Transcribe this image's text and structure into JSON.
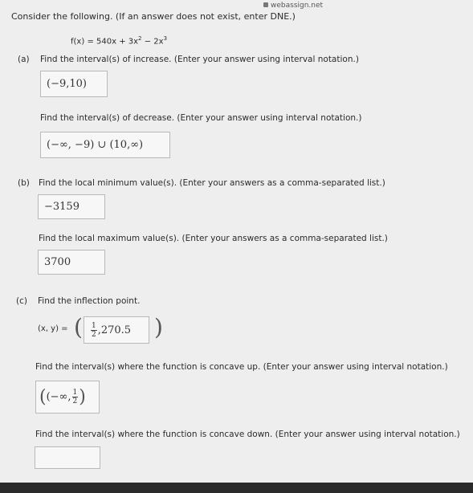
{
  "browser": {
    "url": "webassign.net"
  },
  "intro": "Consider the following. (If an answer does not exist, enter DNE.)",
  "function": {
    "lhs": "f(x)",
    "rhs_a": "540x + 3x",
    "rhs_b": "2x",
    "exp1": "2",
    "exp2": "3",
    "minus": "−",
    "eq": "="
  },
  "part_a": {
    "label": "(a)",
    "q1": "Find the interval(s) of increase. (Enter your answer using interval notation.)",
    "a1": "(−9,10)",
    "q2": "Find the interval(s) of decrease. (Enter your answer using interval notation.)",
    "a2": "(−∞, −9) ∪ (10,∞)"
  },
  "part_b": {
    "label": "(b)",
    "q1": "Find the local minimum value(s). (Enter your answers as a comma-separated list.)",
    "a1": "−3159",
    "q2": "Find the local maximum value(s). (Enter your answers as a comma-separated list.)",
    "a2": "3700"
  },
  "part_c": {
    "label": "(c)",
    "q1": "Find the inflection point.",
    "xy_label": "(x, y) =",
    "point_num": "1",
    "point_den": "2",
    "point_rest": ",270.5",
    "q2": "Find the interval(s) where the function is concave up. (Enter your answer using interval notation.)",
    "a2_prefix": "(−∞, ",
    "a2_num": "1",
    "a2_den": "2",
    "a2_suffix": ")",
    "q3": "Find the interval(s) where the function is concave down. (Enter your answer using interval notation.)",
    "a3": ""
  }
}
